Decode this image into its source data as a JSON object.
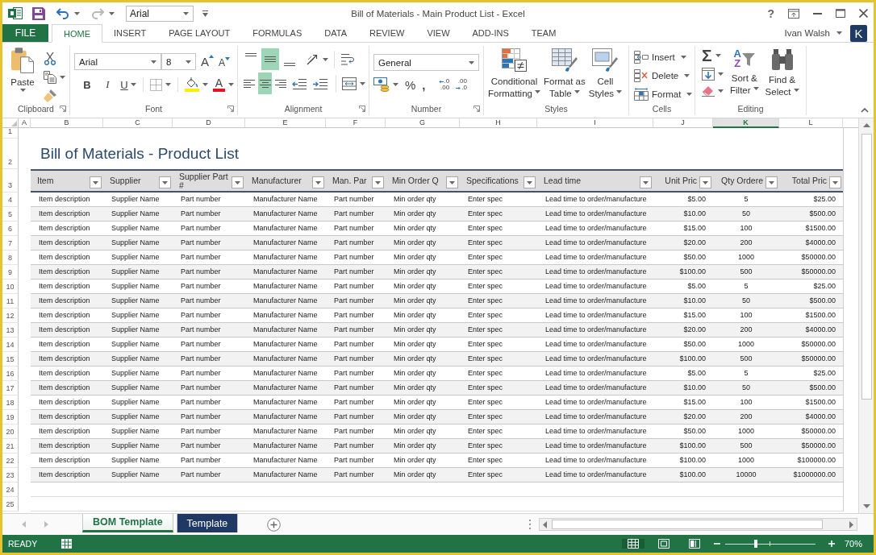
{
  "window": {
    "title": "Bill of Materials - Main Product List - Excel",
    "help": "?"
  },
  "quick_access": {
    "buttons": [
      {
        "kind": "save",
        "disabled": false
      },
      {
        "kind": "undo",
        "disabled": false
      },
      {
        "kind": "redo",
        "disabled": true
      }
    ],
    "font_box": "Arial"
  },
  "tabs": [
    {
      "label": "FILE",
      "kind": "file",
      "selected": false
    },
    {
      "label": "HOME",
      "kind": "tab",
      "selected": true
    },
    {
      "label": "INSERT",
      "kind": "tab",
      "selected": false
    },
    {
      "label": "PAGE LAYOUT",
      "kind": "tab",
      "selected": false
    },
    {
      "label": "FORMULAS",
      "kind": "tab",
      "selected": false
    },
    {
      "label": "DATA",
      "kind": "tab",
      "selected": false
    },
    {
      "label": "REVIEW",
      "kind": "tab",
      "selected": false
    },
    {
      "label": "VIEW",
      "kind": "tab",
      "selected": false
    },
    {
      "label": "ADD-INS",
      "kind": "tab",
      "selected": false
    },
    {
      "label": "TEAM",
      "kind": "tab",
      "selected": false
    }
  ],
  "account": {
    "name": "Ivan Walsh",
    "avatar": "K"
  },
  "ribbon": {
    "clipboard": {
      "label": "Clipboard",
      "paste": "Paste"
    },
    "font": {
      "label": "Font",
      "name": "Arial",
      "size": "8",
      "grow": "A",
      "shrink": "A",
      "styles": [
        {
          "kind": "bold",
          "label": "B"
        },
        {
          "kind": "italic",
          "label": "I"
        },
        {
          "kind": "underline",
          "label": "U"
        }
      ],
      "font_color": "A"
    },
    "alignment": {
      "label": "Alignment",
      "vertical": [
        {
          "kind": "top",
          "selected": false
        },
        {
          "kind": "middle",
          "selected": true
        },
        {
          "kind": "bottom",
          "selected": false
        }
      ],
      "horizontal": [
        {
          "kind": "left",
          "selected": false
        },
        {
          "kind": "center",
          "selected": true
        },
        {
          "kind": "right",
          "selected": false
        }
      ]
    },
    "number": {
      "label": "Number",
      "format": "General",
      "percent": "%",
      "comma": ",",
      "decimals": [
        {
          "kind": "increase",
          "lines": [
            ".0",
            ".00"
          ]
        },
        {
          "kind": "decrease",
          "lines": [
            ".00",
            ".0"
          ]
        }
      ]
    },
    "styles": {
      "label": "Styles",
      "buttons": [
        {
          "kind": "conditional",
          "lines": [
            "Conditional",
            "Formatting"
          ]
        },
        {
          "kind": "table",
          "lines": [
            "Format as",
            "Table"
          ]
        },
        {
          "kind": "cell",
          "lines": [
            "Cell",
            "Styles"
          ]
        }
      ]
    },
    "cells": {
      "label": "Cells",
      "buttons": [
        {
          "kind": "insert",
          "label": "Insert"
        },
        {
          "kind": "delete",
          "label": "Delete"
        },
        {
          "kind": "format",
          "label": "Format"
        }
      ]
    },
    "editing": {
      "label": "Editing",
      "autosum": "Σ",
      "buttons": [
        {
          "kind": "sort",
          "glyphs": [
            "A",
            "Z"
          ],
          "lines": [
            "Sort &",
            "Filter"
          ]
        },
        {
          "kind": "find",
          "lines": [
            "Find &",
            "Select"
          ]
        }
      ]
    }
  },
  "sheet": {
    "columns": [
      {
        "label": "A",
        "selected": false
      },
      {
        "label": "B",
        "selected": false
      },
      {
        "label": "C",
        "selected": false
      },
      {
        "label": "D",
        "selected": false
      },
      {
        "label": "E",
        "selected": false
      },
      {
        "label": "F",
        "selected": false
      },
      {
        "label": "G",
        "selected": false
      },
      {
        "label": "H",
        "selected": false
      },
      {
        "label": "I",
        "selected": false
      },
      {
        "label": "J",
        "selected": false
      },
      {
        "label": "K",
        "selected": true
      },
      {
        "label": "L",
        "selected": false
      }
    ],
    "row_numbers": [
      "1",
      "2",
      "3",
      "4",
      "5",
      "6",
      "7",
      "8",
      "9",
      "10",
      "11",
      "12",
      "13",
      "14",
      "15",
      "16",
      "17",
      "18",
      "19",
      "20",
      "21",
      "22",
      "23",
      "24",
      "25"
    ],
    "title": "Bill of Materials - Product List",
    "table": {
      "columns": [
        {
          "label": "Item",
          "kind": "text"
        },
        {
          "label": "Supplier",
          "kind": "text"
        },
        {
          "label": "Supplier Part #",
          "kind": "text"
        },
        {
          "label": "Manufacturer",
          "kind": "text"
        },
        {
          "label": "Man. Par",
          "kind": "text"
        },
        {
          "label": "Min Order Q",
          "kind": "text"
        },
        {
          "label": "Specifications",
          "kind": "text"
        },
        {
          "label": "Lead time",
          "kind": "text"
        },
        {
          "label": "Unit Pric",
          "kind": "money"
        },
        {
          "label": "Qty Ordere",
          "kind": "count"
        },
        {
          "label": "Total Pric",
          "kind": "money"
        }
      ],
      "rows": [
        [
          "Item description",
          "Supplier Name",
          "Part number",
          "Manufacturer Name",
          "Part number",
          "Min order qty",
          "Enter spec",
          "Lead time to order/manufacture",
          "$5.00",
          "5",
          "$25.00"
        ],
        [
          "Item description",
          "Supplier Name",
          "Part number",
          "Manufacturer Name",
          "Part number",
          "Min order qty",
          "Enter spec",
          "Lead time to order/manufacture",
          "$10.00",
          "50",
          "$500.00"
        ],
        [
          "Item description",
          "Supplier Name",
          "Part number",
          "Manufacturer Name",
          "Part number",
          "Min order qty",
          "Enter spec",
          "Lead time to order/manufacture",
          "$15.00",
          "100",
          "$1500.00"
        ],
        [
          "Item description",
          "Supplier Name",
          "Part number",
          "Manufacturer Name",
          "Part number",
          "Min order qty",
          "Enter spec",
          "Lead time to order/manufacture",
          "$20.00",
          "200",
          "$4000.00"
        ],
        [
          "Item description",
          "Supplier Name",
          "Part number",
          "Manufacturer Name",
          "Part number",
          "Min order qty",
          "Enter spec",
          "Lead time to order/manufacture",
          "$50.00",
          "1000",
          "$50000.00"
        ],
        [
          "Item description",
          "Supplier Name",
          "Part number",
          "Manufacturer Name",
          "Part number",
          "Min order qty",
          "Enter spec",
          "Lead time to order/manufacture",
          "$100.00",
          "500",
          "$50000.00"
        ],
        [
          "Item description",
          "Supplier Name",
          "Part number",
          "Manufacturer Name",
          "Part number",
          "Min order qty",
          "Enter spec",
          "Lead time to order/manufacture",
          "$5.00",
          "5",
          "$25.00"
        ],
        [
          "Item description",
          "Supplier Name",
          "Part number",
          "Manufacturer Name",
          "Part number",
          "Min order qty",
          "Enter spec",
          "Lead time to order/manufacture",
          "$10.00",
          "50",
          "$500.00"
        ],
        [
          "Item description",
          "Supplier Name",
          "Part number",
          "Manufacturer Name",
          "Part number",
          "Min order qty",
          "Enter spec",
          "Lead time to order/manufacture",
          "$15.00",
          "100",
          "$1500.00"
        ],
        [
          "Item description",
          "Supplier Name",
          "Part number",
          "Manufacturer Name",
          "Part number",
          "Min order qty",
          "Enter spec",
          "Lead time to order/manufacture",
          "$20.00",
          "200",
          "$4000.00"
        ],
        [
          "Item description",
          "Supplier Name",
          "Part number",
          "Manufacturer Name",
          "Part number",
          "Min order qty",
          "Enter spec",
          "Lead time to order/manufacture",
          "$50.00",
          "1000",
          "$50000.00"
        ],
        [
          "Item description",
          "Supplier Name",
          "Part number",
          "Manufacturer Name",
          "Part number",
          "Min order qty",
          "Enter spec",
          "Lead time to order/manufacture",
          "$100.00",
          "500",
          "$50000.00"
        ],
        [
          "Item description",
          "Supplier Name",
          "Part number",
          "Manufacturer Name",
          "Part number",
          "Min order qty",
          "Enter spec",
          "Lead time to order/manufacture",
          "$5.00",
          "5",
          "$25.00"
        ],
        [
          "Item description",
          "Supplier Name",
          "Part number",
          "Manufacturer Name",
          "Part number",
          "Min order qty",
          "Enter spec",
          "Lead time to order/manufacture",
          "$10.00",
          "50",
          "$500.00"
        ],
        [
          "Item description",
          "Supplier Name",
          "Part number",
          "Manufacturer Name",
          "Part number",
          "Min order qty",
          "Enter spec",
          "Lead time to order/manufacture",
          "$15.00",
          "100",
          "$1500.00"
        ],
        [
          "Item description",
          "Supplier Name",
          "Part number",
          "Manufacturer Name",
          "Part number",
          "Min order qty",
          "Enter spec",
          "Lead time to order/manufacture",
          "$20.00",
          "200",
          "$4000.00"
        ],
        [
          "Item description",
          "Supplier Name",
          "Part number",
          "Manufacturer Name",
          "Part number",
          "Min order qty",
          "Enter spec",
          "Lead time to order/manufacture",
          "$50.00",
          "1000",
          "$50000.00"
        ],
        [
          "Item description",
          "Supplier Name",
          "Part number",
          "Manufacturer Name",
          "Part number",
          "Min order qty",
          "Enter spec",
          "Lead time to order/manufacture",
          "$100.00",
          "500",
          "$50000.00"
        ],
        [
          "Item description",
          "Supplier Name",
          "Part number",
          "Manufacturer Name",
          "Part number",
          "Min order qty",
          "Enter spec",
          "Lead time to order/manufacture",
          "$100.00",
          "1000",
          "$100000.00"
        ],
        [
          "Item description",
          "Supplier Name",
          "Part number",
          "Manufacturer Name",
          "Part number",
          "Min order qty",
          "Enter spec",
          "Lead time to order/manufacture",
          "$100.00",
          "10000",
          "$1000000.00"
        ]
      ]
    }
  },
  "sheet_tabs": [
    {
      "label": "BOM Template",
      "selected": true,
      "color": "#217346"
    },
    {
      "label": "Template",
      "selected": false,
      "color": "#1f3864"
    }
  ],
  "status_bar": {
    "mode": "READY",
    "views": [
      {
        "kind": "normal",
        "selected": true
      },
      {
        "kind": "page_layout",
        "selected": false
      },
      {
        "kind": "page_break",
        "selected": false
      }
    ],
    "zoom": {
      "level": 0.34,
      "reading": "70%"
    }
  }
}
